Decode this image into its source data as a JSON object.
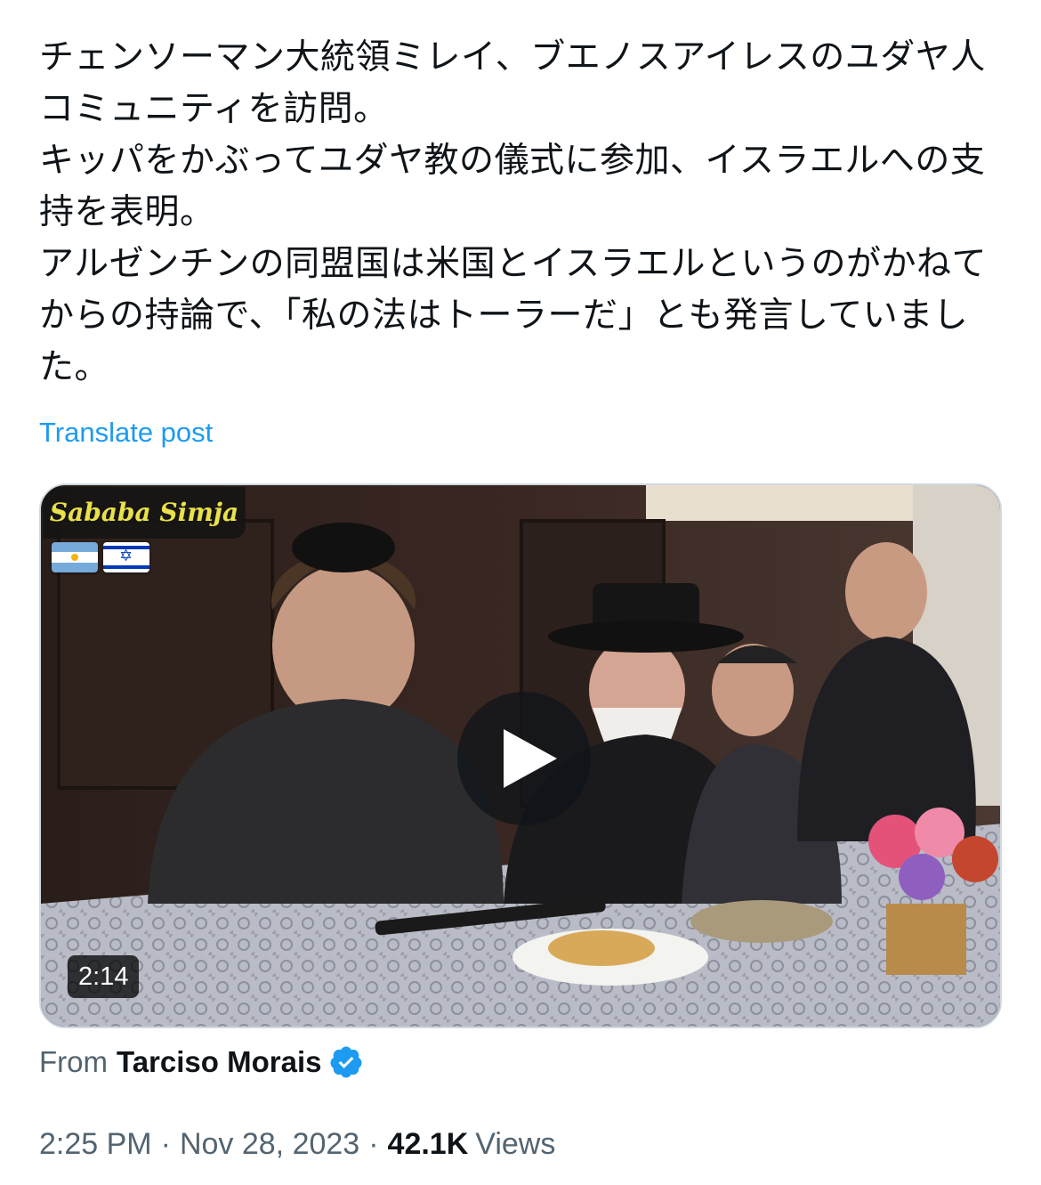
{
  "post": {
    "text": "チェンソーマン大統領ミレイ、ブエノスアイレスのユダヤ人コミュニティを訪問。\nキッパをかぶってユダヤ教の儀式に参加、イスラエルへの支持を表明。\nアルゼンチンの同盟国は米国とイスラエルというのがかねてからの持論で、「私の法はトーラーだ」とも発言していました。",
    "translate_label": "Translate post"
  },
  "media": {
    "watermark": "Sababa Simja",
    "flags": [
      "argentina-flag",
      "israel-flag"
    ],
    "duration": "2:14",
    "play_icon": "play-icon"
  },
  "source": {
    "prefix": "From",
    "author": "Tarciso Morais",
    "verified": true,
    "verified_color": "#1d9bf0"
  },
  "meta": {
    "time": "2:25 PM",
    "separator": "·",
    "date": "Nov 28, 2023",
    "views_count": "42.1K",
    "views_label": "Views"
  },
  "colors": {
    "text": "#0f1419",
    "secondary": "#536471",
    "link": "#1d9bf0",
    "border": "#cfd9de"
  }
}
